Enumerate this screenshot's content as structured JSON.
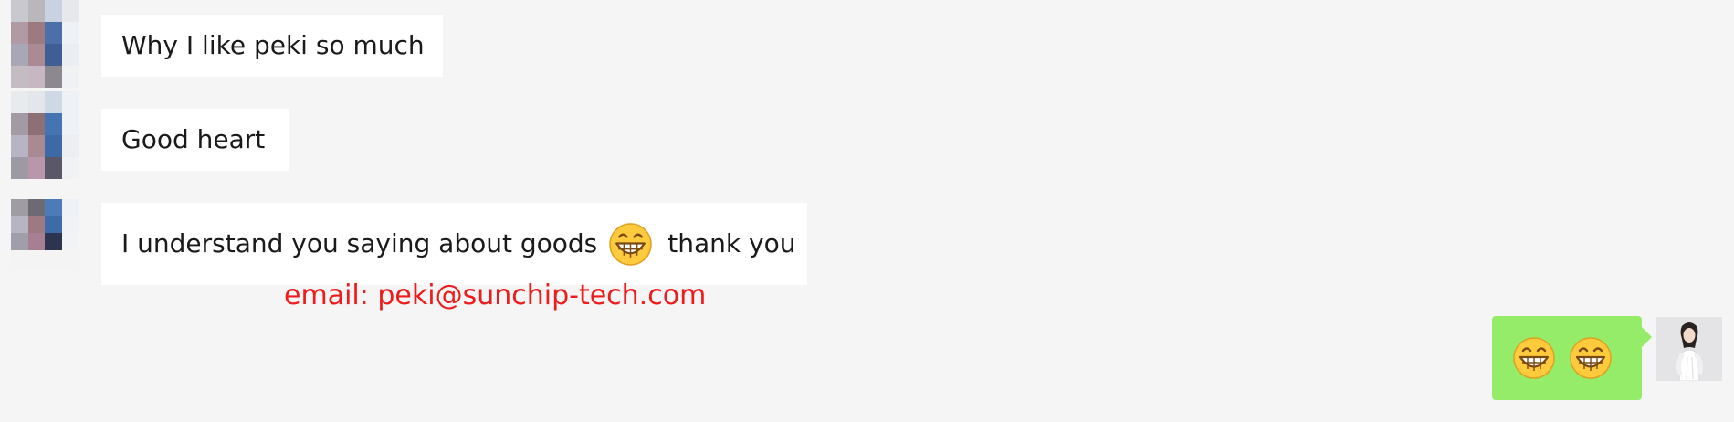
{
  "chat": {
    "messages": [
      {
        "sender": "contact",
        "text": "Why I like peki so much"
      },
      {
        "sender": "contact",
        "text": "Good heart"
      },
      {
        "sender": "contact",
        "text_before": "I understand you saying about goods",
        "emoji": "grinning-face-emoji",
        "text_after": "thank you"
      },
      {
        "sender": "me",
        "emojis": [
          "grinning-face-emoji",
          "grinning-face-emoji"
        ]
      }
    ]
  },
  "overlay": {
    "email_text": "email: peki@sunchip-tech.com",
    "color": "#ee1c1c"
  },
  "theme": {
    "background": "#f5f5f5",
    "incoming_bubble": "#ffffff",
    "outgoing_bubble": "#95ec69",
    "emoji_face": "#ffcb3d"
  },
  "icons": {
    "contact_avatar": "pixelated-contact-avatar",
    "my_avatar": "woman-in-white-avatar"
  }
}
